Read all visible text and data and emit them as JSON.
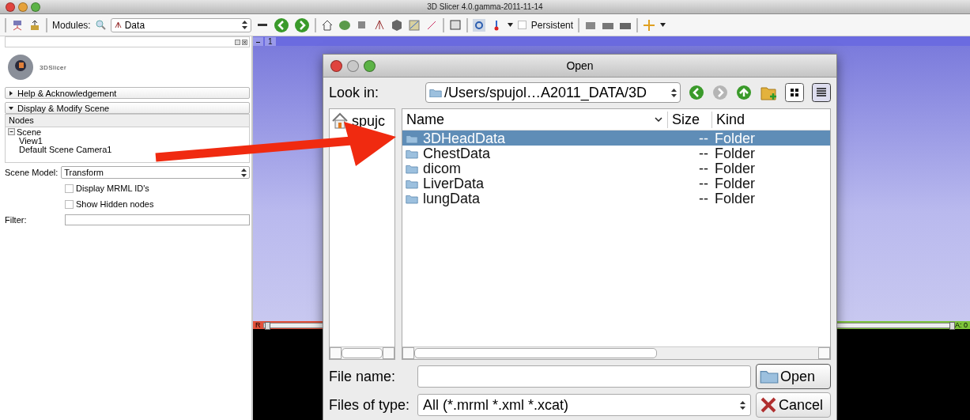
{
  "window": {
    "title": "3D Slicer 4.0.gamma-2011-11-14"
  },
  "toolbar": {
    "modules_label": "Modules:",
    "module_select": "Data",
    "persistent": {
      "label": "Persistent",
      "checked": false
    }
  },
  "panel": {
    "logo_text": "3DSlicer",
    "sections": [
      {
        "label": "Help & Acknowledgement",
        "expanded": false
      },
      {
        "label": "Display & Modify Scene",
        "expanded": true
      }
    ],
    "tree_header": "Nodes",
    "tree": [
      {
        "label": "Scene",
        "expanded": true,
        "children": [
          {
            "label": "View1"
          },
          {
            "label": "Default Scene Camera1"
          }
        ]
      }
    ],
    "scene_model": {
      "label": "Scene Model:",
      "value": "Transform"
    },
    "options": [
      {
        "label": "Display MRML ID's",
        "checked": false
      },
      {
        "label": "Show Hidden nodes",
        "checked": false
      }
    ],
    "filter": {
      "label": "Filter:"
    }
  },
  "views": {
    "layout_tab": "1",
    "red_slice": {
      "label": "R",
      "level": 0.01
    },
    "green_slice": {
      "label": "A: 0",
      "level": 1
    }
  },
  "dialog": {
    "title": "Open",
    "look_in_label": "Look in:",
    "path": "/Users/spujol…A2011_DATA/3D",
    "sidebar": [
      "spujc"
    ],
    "columns": [
      "Name",
      "Size",
      "Kind"
    ],
    "rows": [
      {
        "name": "3DHeadData",
        "size": "--",
        "kind": "Folder",
        "selected": true
      },
      {
        "name": "ChestData",
        "size": "--",
        "kind": "Folder",
        "selected": false
      },
      {
        "name": "dicom",
        "size": "--",
        "kind": "Folder",
        "selected": false
      },
      {
        "name": "LiverData",
        "size": "--",
        "kind": "Folder",
        "selected": false
      },
      {
        "name": "lungData",
        "size": "--",
        "kind": "Folder",
        "selected": false
      }
    ],
    "file_name_label": "File name:",
    "file_type_label": "Files of type:",
    "file_type": "All (*.mrml *.xml *.xcat)",
    "buttons": [
      {
        "label": "Open",
        "kind": "open"
      },
      {
        "label": "Cancel",
        "kind": "cancel"
      }
    ]
  }
}
